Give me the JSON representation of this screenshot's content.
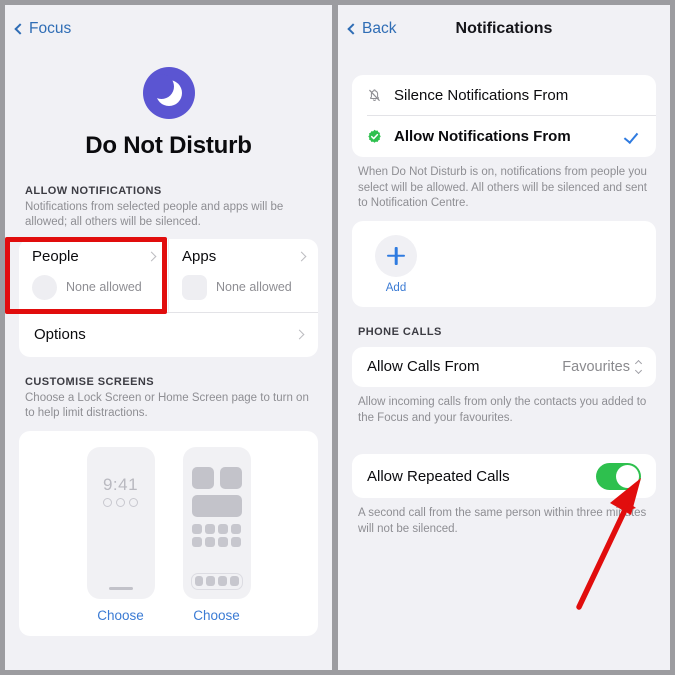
{
  "accent": {
    "ios_blue": "#2f7be0",
    "ios_green": "#2ec04e",
    "dnd_purple": "#5b55d2",
    "highlight_red": "#e10d0d",
    "page_bg": "#f1f1f5",
    "card_bg": "#ffffff",
    "secondary_text": "#8e8e93"
  },
  "left_panel": {
    "nav": {
      "back_label": "Focus",
      "back_icon": "chevron-left-icon"
    },
    "hero": {
      "icon": "crescent-moon-icon",
      "title": "Do Not Disturb"
    },
    "allow_notifications": {
      "header": "ALLOW NOTIFICATIONS",
      "subtitle": "Notifications from selected people and apps will be allowed; all others will be silenced.",
      "cells": [
        {
          "title": "People",
          "placeholder_shape": "circle",
          "status": "None allowed",
          "chevron": "chevron-right-icon",
          "highlighted": true
        },
        {
          "title": "Apps",
          "placeholder_shape": "rounded-square",
          "status": "None allowed",
          "chevron": "chevron-right-icon",
          "highlighted": false
        }
      ],
      "options_row": {
        "label": "Options",
        "chevron": "chevron-right-icon"
      }
    },
    "customise_screens": {
      "header": "CUSTOMISE SCREENS",
      "subtitle": "Choose a Lock Screen or Home Screen page to turn on to help limit distractions.",
      "lock_screen": {
        "time": "9:41",
        "choose_label": "Choose"
      },
      "home_screen": {
        "choose_label": "Choose"
      }
    }
  },
  "right_panel": {
    "nav": {
      "back_label": "Back",
      "back_icon": "chevron-left-icon",
      "title": "Notifications"
    },
    "mode_options": [
      {
        "label": "Silence Notifications From",
        "icon": "bell-slash-icon",
        "selected": false,
        "bold": false
      },
      {
        "label": "Allow Notifications From",
        "icon": "green-check-badge-icon",
        "selected": true,
        "bold": true,
        "check_icon": "checkmark-icon"
      }
    ],
    "mode_footer": "When Do Not Disturb is on, notifications from people you select will be allowed. All others will be silenced and sent to Notification Centre.",
    "add": {
      "icon": "plus-icon",
      "label": "Add"
    },
    "phone_calls": {
      "header": "PHONE CALLS",
      "allow_calls_from": {
        "label": "Allow Calls From",
        "value": "Favourites",
        "selector_icon": "chevron-up-down-icon"
      },
      "allow_calls_footer": "Allow incoming calls from only the contacts you added to the Focus and your favourites.",
      "allow_repeated_calls": {
        "label": "Allow Repeated Calls",
        "toggle_state": "on"
      },
      "repeated_footer": "A second call from the same person within three minutes will not be silenced."
    }
  },
  "annotations": {
    "arrow": {
      "name": "red-pointer-arrow",
      "target": "allow-repeated-calls-toggle",
      "color": "#e10d0d"
    },
    "highlight_box": {
      "name": "red-highlight-box",
      "target": "people-cell",
      "color": "#e10d0d"
    }
  }
}
